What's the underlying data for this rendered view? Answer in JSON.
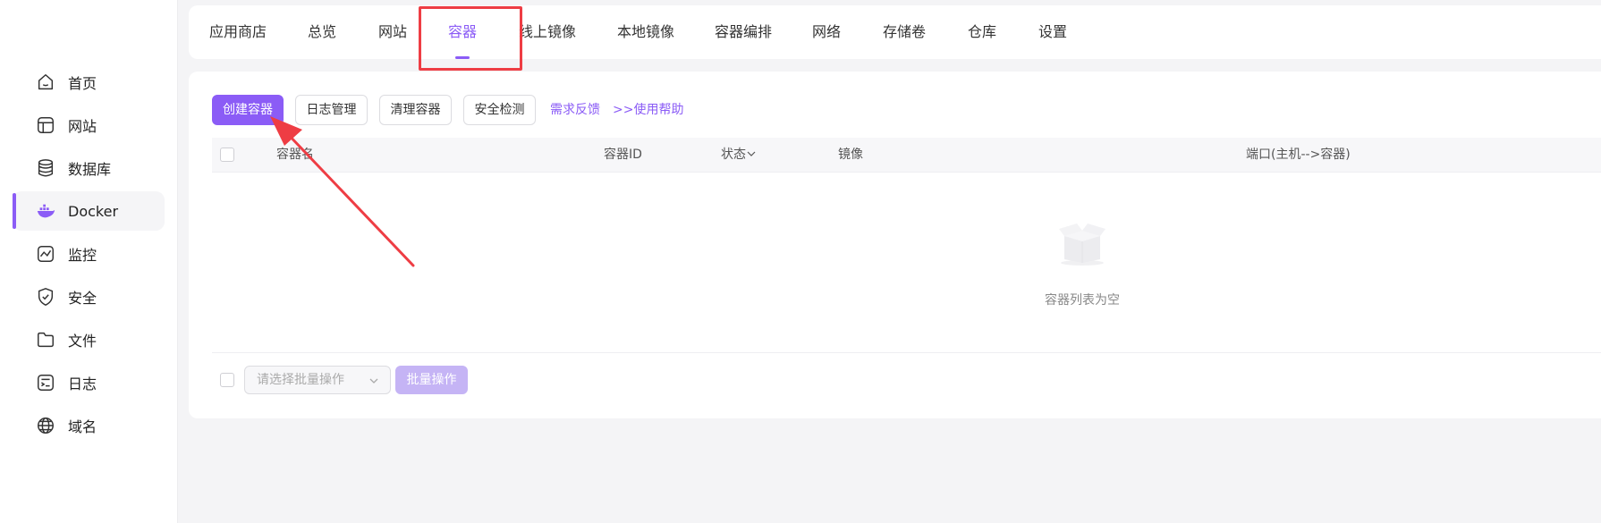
{
  "sidebar": {
    "items": [
      {
        "label": "首页",
        "icon": "home-icon"
      },
      {
        "label": "网站",
        "icon": "website-icon"
      },
      {
        "label": "数据库",
        "icon": "database-icon"
      },
      {
        "label": "Docker",
        "icon": "docker-icon",
        "active": true
      },
      {
        "label": "监控",
        "icon": "monitor-icon"
      },
      {
        "label": "安全",
        "icon": "shield-icon"
      },
      {
        "label": "文件",
        "icon": "folder-icon"
      },
      {
        "label": "日志",
        "icon": "log-icon"
      },
      {
        "label": "域名",
        "icon": "globe-icon"
      }
    ]
  },
  "tabs": [
    {
      "label": "应用商店"
    },
    {
      "label": "总览"
    },
    {
      "label": "网站"
    },
    {
      "label": "容器",
      "active": true
    },
    {
      "label": "线上镜像"
    },
    {
      "label": "本地镜像"
    },
    {
      "label": "容器编排"
    },
    {
      "label": "网络"
    },
    {
      "label": "存储卷"
    },
    {
      "label": "仓库"
    },
    {
      "label": "设置"
    }
  ],
  "toolbar": {
    "create_label": "创建容器",
    "log_label": "日志管理",
    "clean_label": "清理容器",
    "security_label": "安全检测",
    "feedback_link": "需求反馈",
    "help_link": ">>使用帮助"
  },
  "table": {
    "columns": {
      "name": "容器名",
      "id": "容器ID",
      "status": "状态",
      "image": "镜像",
      "port": "端口(主机-->容器)"
    },
    "empty_text": "容器列表为空"
  },
  "batch": {
    "select_placeholder": "请选择批量操作",
    "button_label": "批量操作"
  },
  "colors": {
    "accent": "#8b5cf6",
    "highlight": "#ee3d44"
  }
}
